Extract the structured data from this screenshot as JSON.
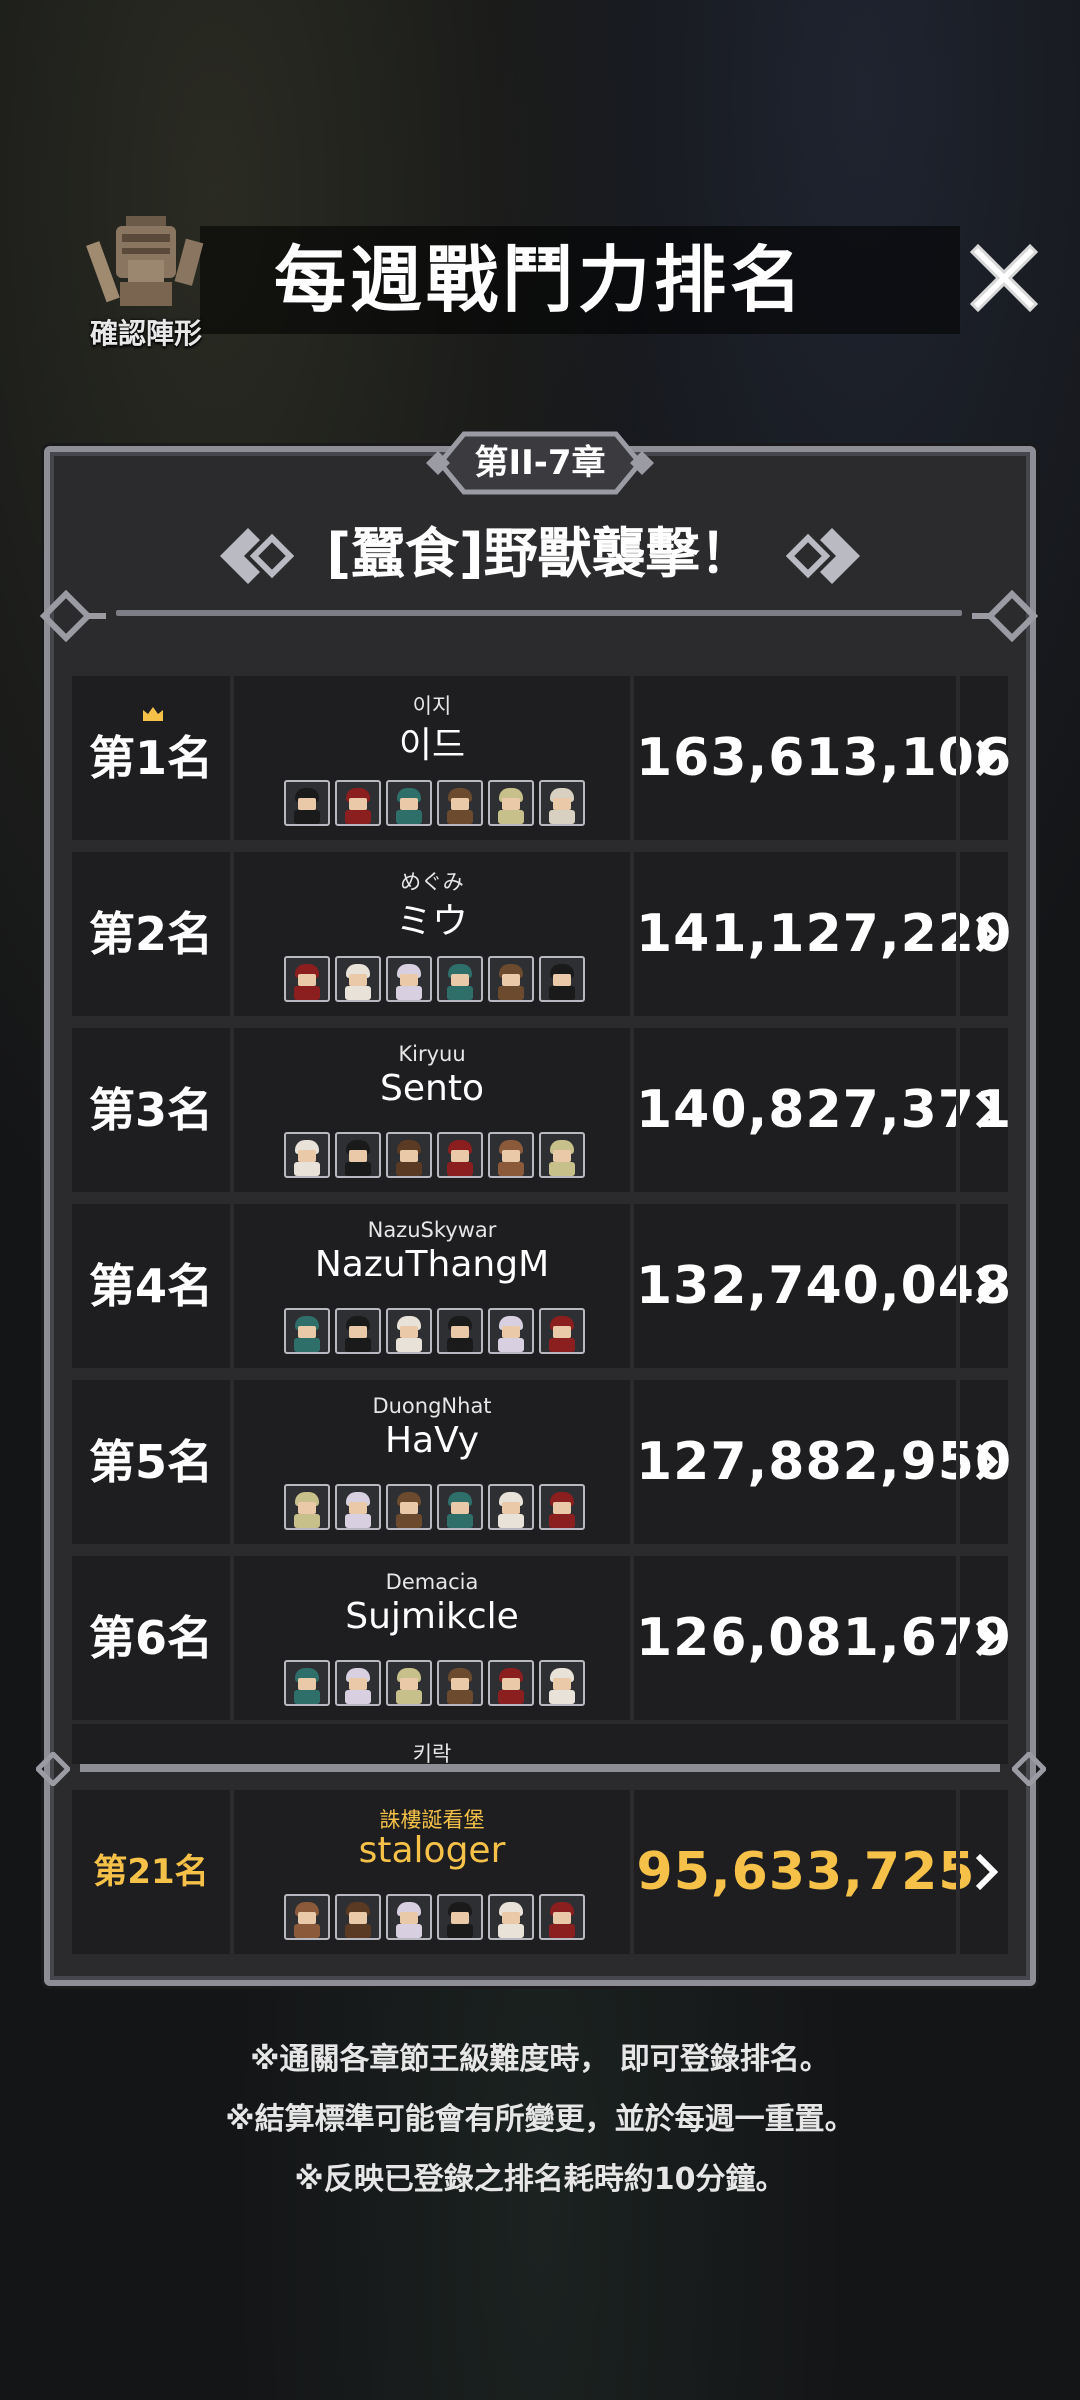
{
  "header": {
    "title": "每週戰鬥力排名",
    "formation_label": "確認陣形"
  },
  "panel": {
    "chapter": "第II-7章",
    "stage_title": "[蠶食]野獸襲擊！"
  },
  "rankings": [
    {
      "rank": "第1名",
      "guild": "이지",
      "name": "이드",
      "power": "163,613,106",
      "crown": true,
      "team": [
        "#1a1a1a",
        "#8b1e1e",
        "#2f6f6a",
        "#6b4a2e",
        "#c8c08a",
        "#d8d0c0"
      ]
    },
    {
      "rank": "第2名",
      "guild": "めぐみ",
      "name": "ミウ",
      "power": "141,127,220",
      "team": [
        "#8b1e1e",
        "#e8e2d8",
        "#d8d0e0",
        "#2f6f6a",
        "#6b4a2e",
        "#1a1a1a"
      ]
    },
    {
      "rank": "第3名",
      "guild": "Kiryuu",
      "name": "Sento",
      "power": "140,827,371",
      "team": [
        "#e8e2d8",
        "#1a1a1a",
        "#5a3a22",
        "#8b1e1e",
        "#8a5a3a",
        "#c8c08a"
      ]
    },
    {
      "rank": "第4名",
      "guild": "NazuSkywar",
      "name": "NazuThangM",
      "power": "132,740,048",
      "team": [
        "#2f6f6a",
        "#1a1a1a",
        "#e8e2d8",
        "#1a1a1a",
        "#d8d0e0",
        "#8b1e1e"
      ]
    },
    {
      "rank": "第5名",
      "guild": "DuongNhat",
      "name": "HaVy",
      "power": "127,882,950",
      "team": [
        "#c8c08a",
        "#d8d0e0",
        "#6b4a2e",
        "#2f6f6a",
        "#e8e2d8",
        "#8b1e1e"
      ]
    },
    {
      "rank": "第6名",
      "guild": "Demacia",
      "name": "Sujmikcle",
      "power": "126,081,679",
      "team": [
        "#2f6f6a",
        "#d8d0e0",
        "#c8c08a",
        "#6b4a2e",
        "#8b1e1e",
        "#e8e2d8"
      ]
    }
  ],
  "partial_row": {
    "guild": "키락"
  },
  "my_rank": {
    "rank": "第21名",
    "guild": "誅樓誕看堡",
    "name": "staloger",
    "power": "95,633,725",
    "team": [
      "#8a5a3a",
      "#5a3a22",
      "#d8d0e0",
      "#1a1a1a",
      "#e8e2d8",
      "#8b1e1e"
    ]
  },
  "notes": [
    "※通關各章節王級難度時， 即可登錄排名。",
    "※結算標準可能會有所變更，並於每週一重置。",
    "※反映已登錄之排名耗時約10分鐘。"
  ],
  "icons": {
    "close": "close-icon",
    "arrow": "chevron-right-icon",
    "crown": "crown-icon",
    "formation": "knight-helmet-icon"
  },
  "colors": {
    "highlight": "#f5c148",
    "panel_border": "#8d8e96",
    "row_bg": "#1e1e20"
  }
}
